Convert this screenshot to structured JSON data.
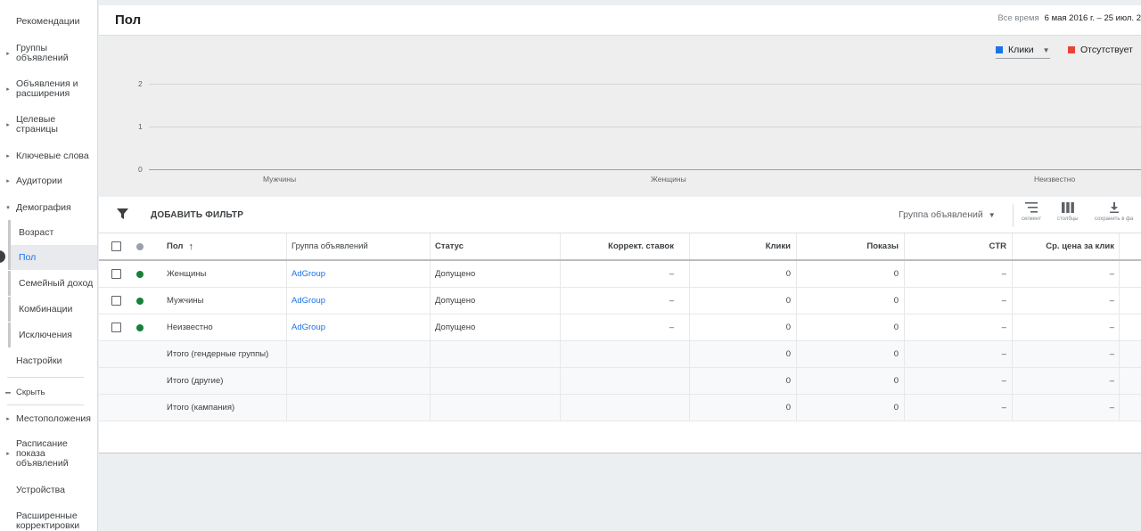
{
  "sidebar": {
    "items": [
      {
        "label": "Рекомендации",
        "caret": false
      },
      {
        "label": "Группы\nобъявлений",
        "caret": true
      },
      {
        "label": "Объявления и\nрасширения",
        "caret": true
      },
      {
        "label": "Целевые\nстраницы",
        "caret": true
      },
      {
        "label": "Ключевые слова",
        "caret": true
      },
      {
        "label": "Аудитории",
        "caret": true
      },
      {
        "label": "Демография",
        "caret": true,
        "expanded": true
      }
    ],
    "demography_subitems": [
      {
        "label": "Возраст",
        "active": false
      },
      {
        "label": "Пол",
        "active": true
      },
      {
        "label": "Семейный доход",
        "active": false
      },
      {
        "label": "Комбинации",
        "active": false
      },
      {
        "label": "Исключения",
        "active": false
      }
    ],
    "settings_label": "Настройки",
    "hide_label": "Скрыть",
    "lower_items": [
      {
        "label": "Местоположения",
        "caret": true
      },
      {
        "label": "Расписание\nпоказа\nобъявлений",
        "caret": true
      },
      {
        "label": "Устройства",
        "caret": false
      },
      {
        "label": "Расширенные\nкорректировки",
        "caret": false
      }
    ]
  },
  "header": {
    "title": "Пол",
    "date_label": "Все время",
    "date_range": "6 мая 2016 г. – 25 июл. 2"
  },
  "chart": {
    "legend": [
      {
        "label": "Клики",
        "color": "#1a73e8",
        "dropdown": true
      },
      {
        "label": "Отсутствует",
        "color": "#ea4335",
        "dropdown": false
      }
    ]
  },
  "chart_data": {
    "type": "bar",
    "categories": [
      "Мужчины",
      "Женщины",
      "Неизвестно"
    ],
    "series": [
      {
        "name": "Клики",
        "values": [
          0,
          0,
          0
        ]
      }
    ],
    "yticks": [
      "0",
      "1",
      "2"
    ],
    "ylim": [
      0,
      2
    ],
    "grid": true
  },
  "toolbar": {
    "add_filter_label": "ДОБАВИТЬ ФИЛЬТР",
    "group_select_label": "Группа объявлений",
    "segment_label": "сегмент",
    "columns_label": "столбцы",
    "download_label": "сохранить в фа"
  },
  "table": {
    "columns": [
      "Пол",
      "Группа объявлений",
      "Статус",
      "Коррект. ставок",
      "Клики",
      "Показы",
      "CTR",
      "Ср. цена за клик"
    ],
    "sort_arrow": "↑",
    "rows": [
      {
        "gender": "Женщины",
        "ad_group": "AdGroup",
        "status": "Допущено",
        "bid_adj": "–",
        "clicks": "0",
        "impressions": "0",
        "ctr": "–",
        "cpc": "–"
      },
      {
        "gender": "Мужчины",
        "ad_group": "AdGroup",
        "status": "Допущено",
        "bid_adj": "–",
        "clicks": "0",
        "impressions": "0",
        "ctr": "–",
        "cpc": "–"
      },
      {
        "gender": "Неизвестно",
        "ad_group": "AdGroup",
        "status": "Допущено",
        "bid_adj": "–",
        "clicks": "0",
        "impressions": "0",
        "ctr": "–",
        "cpc": "–"
      }
    ],
    "totals": [
      {
        "label": "Итого (гендерные группы)",
        "clicks": "0",
        "impressions": "0",
        "ctr": "–",
        "cpc": "–"
      },
      {
        "label": "Итого (другие)",
        "clicks": "0",
        "impressions": "0",
        "ctr": "–",
        "cpc": "–"
      },
      {
        "label": "Итого (кампания)",
        "clicks": "0",
        "impressions": "0",
        "ctr": "–",
        "cpc": "–"
      }
    ],
    "status_color": "#188038",
    "header_dot_color": "#9aa0a6"
  }
}
